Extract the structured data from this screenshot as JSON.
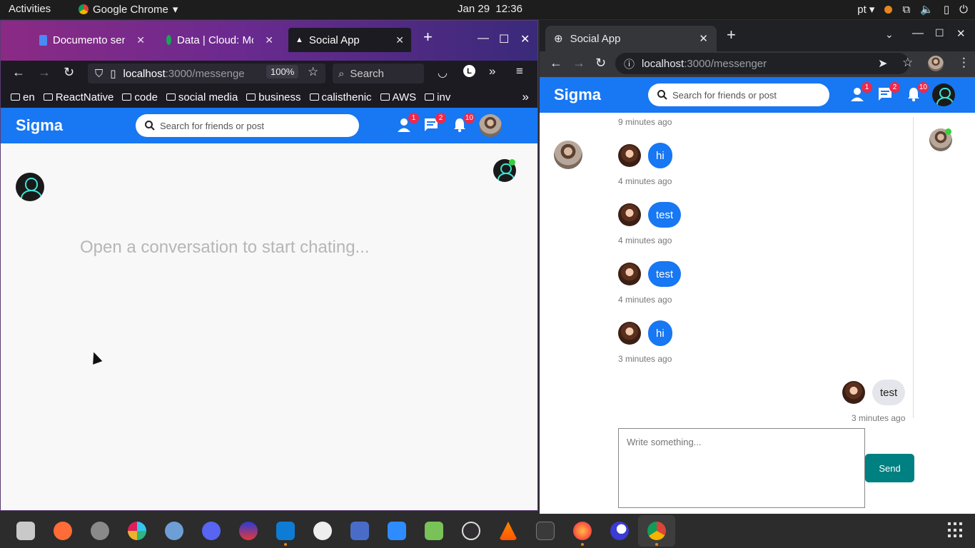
{
  "topbar": {
    "activities": "Activities",
    "app": "Google Chrome",
    "date": "Jan 29",
    "time": "12:36",
    "lang": "pt"
  },
  "firefox": {
    "tabs": [
      "Documento sem t",
      "Data | Cloud: Mon",
      "Social App"
    ],
    "url_host": "localhost",
    "url_path": ":3000/messenge",
    "zoom": "100%",
    "search_label": "Search",
    "bookmarks": [
      "en",
      "ReactNative",
      "code",
      "social media",
      "business",
      "calisthenic",
      "AWS",
      "inv"
    ]
  },
  "app": {
    "logo": "Sigma",
    "search_placeholder": "Search for friends or post",
    "friend_requests": "1",
    "messages": "2",
    "notifications": "10"
  },
  "left_messenger": {
    "empty_text": "Open a conversation to start chating..."
  },
  "chrome": {
    "tab_title": "Social App",
    "url_host": "localhost",
    "url_path": ":3000/messenger"
  },
  "chat": {
    "top_time": "9 minutes ago",
    "messages": [
      {
        "text": "hi",
        "time": "4 minutes ago"
      },
      {
        "text": "test",
        "time": "4 minutes ago"
      },
      {
        "text": "test",
        "time": "4 minutes ago"
      },
      {
        "text": "hi",
        "time": "3 minutes ago"
      },
      {
        "text": "test",
        "time": "3 minutes ago"
      }
    ],
    "input_placeholder": "Write something...",
    "send_label": "Send"
  },
  "colors": {
    "brand": "#1877f2",
    "send": "#008080",
    "online": "#37d13d"
  }
}
